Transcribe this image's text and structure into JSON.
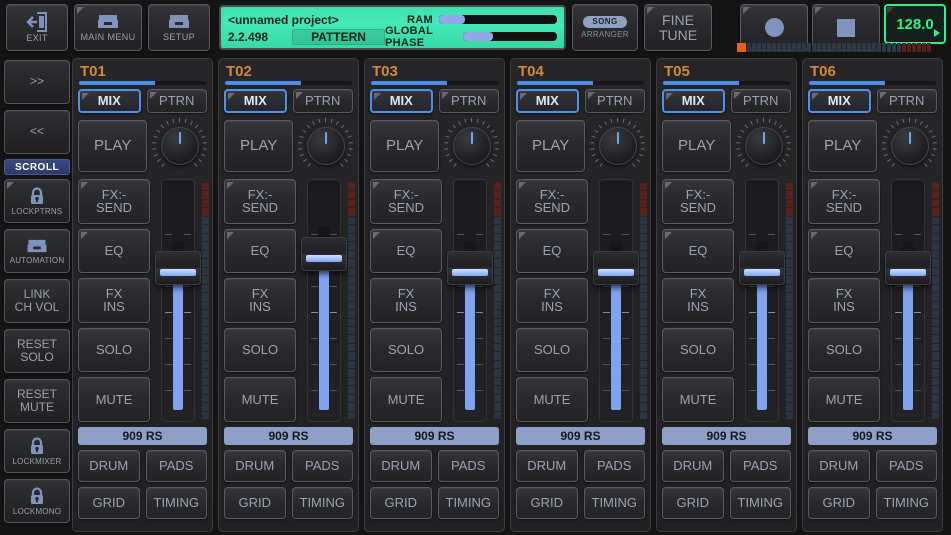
{
  "header": {
    "exit": {
      "label": "EXIT",
      "icon": "exit-door-icon"
    },
    "main_menu": {
      "label": "MAIN MENU",
      "icon": "file-box-icon"
    },
    "setup": {
      "label": "SETUP",
      "icon": "file-box-icon"
    },
    "lcd": {
      "project_name": "<unnamed project>",
      "version": "2.2.498",
      "pattern_label": "PATTERN",
      "ram_label": "RAM",
      "ram_percent": 22,
      "global_phase_label": "GLOBAL PHASE",
      "global_phase_percent": 32,
      "bg_color": "#3fe0ae"
    },
    "song": {
      "label": "SONG",
      "sub_label": "ARRANGER"
    },
    "fine_tune": {
      "line1": "FINE",
      "line2": "TUNE"
    },
    "record": {
      "icon": "record-circle-icon"
    },
    "stop": {
      "icon": "stop-square-icon"
    },
    "bpm": {
      "value": "128.0",
      "color": "#2ff08a"
    },
    "led_strip": {
      "total": 38,
      "red_from": 32,
      "active_index": 0,
      "active_color": "#e8611b"
    }
  },
  "sidebar": {
    "items": [
      {
        "name": "scroll-forward",
        "label": ">>",
        "icon": null,
        "type": "button"
      },
      {
        "name": "scroll-back",
        "label": "<<",
        "icon": null,
        "type": "button"
      },
      {
        "name": "scroll",
        "label": "SCROLL",
        "icon": null,
        "type": "highlight"
      },
      {
        "name": "lockptrns",
        "label": "LOCKPTRNS",
        "icon": "lock-icon",
        "type": "icon-button"
      },
      {
        "name": "automation",
        "label": "AUTOMATION",
        "icon": "file-box-icon",
        "type": "icon-button"
      },
      {
        "name": "link-ch-vol",
        "label": "LINK\nCH VOL",
        "line1": "LINK",
        "line2": "CH VOL",
        "type": "button"
      },
      {
        "name": "reset-solo",
        "label": "RESET SOLO",
        "line1": "RESET",
        "line2": "SOLO",
        "type": "button"
      },
      {
        "name": "reset-mute",
        "label": "RESET MUTE",
        "line1": "RESET",
        "line2": "MUTE",
        "type": "button"
      },
      {
        "name": "lockmixer",
        "label": "LOCKMIXER",
        "icon": "lock-icon",
        "type": "icon-button"
      },
      {
        "name": "lockmono",
        "label": "LOCKMONO",
        "icon": "lock-icon",
        "type": "icon-button"
      }
    ]
  },
  "channel_labels": {
    "mix": "MIX",
    "ptrn": "PTRN",
    "play": "PLAY",
    "fx_send": "FX:-SEND",
    "fx_send_l1": "FX:-",
    "fx_send_l2": "SEND",
    "eq": "EQ",
    "fx_ins": "FX INS",
    "fx_ins_l1": "FX",
    "fx_ins_l2": "INS",
    "solo": "SOLO",
    "mute": "MUTE",
    "drum": "DRUM",
    "pads": "PADS",
    "grid": "GRID",
    "timing": "TIMING"
  },
  "channels": [
    {
      "title": "T01",
      "progress": 60,
      "preset": "909 RS",
      "fader": 64,
      "knob": 0,
      "mix_active": true
    },
    {
      "title": "T02",
      "progress": 60,
      "preset": "909 RS",
      "fader": 71,
      "knob": 0,
      "mix_active": true
    },
    {
      "title": "T03",
      "progress": 60,
      "preset": "909 RS",
      "fader": 64,
      "knob": 0,
      "mix_active": true
    },
    {
      "title": "T04",
      "progress": 60,
      "preset": "909 RS",
      "fader": 64,
      "knob": 0,
      "mix_active": true
    },
    {
      "title": "T05",
      "progress": 60,
      "preset": "909 RS",
      "fader": 64,
      "knob": 0,
      "mix_active": true
    },
    {
      "title": "T06",
      "progress": 60,
      "preset": "909 RS",
      "fader": 64,
      "knob": 0,
      "mix_active": true
    }
  ]
}
